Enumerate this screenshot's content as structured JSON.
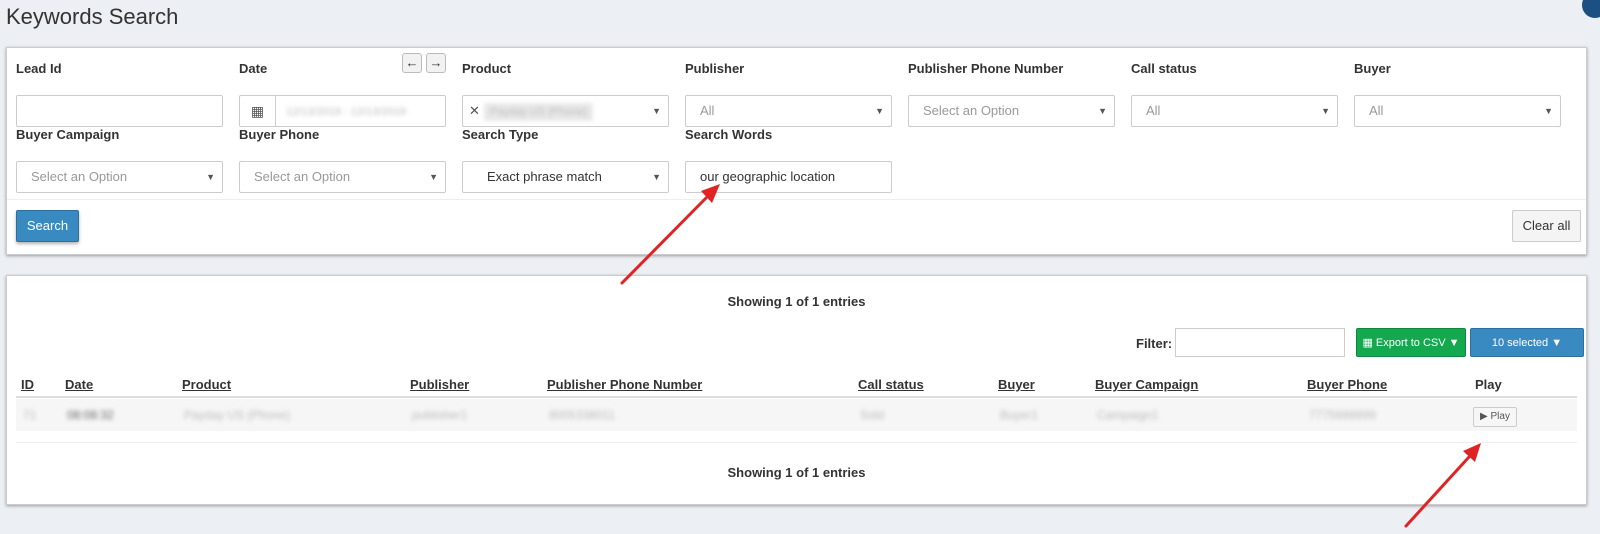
{
  "page": {
    "title": "Keywords Search"
  },
  "filters": {
    "lead_id": {
      "label": "Lead Id",
      "value": ""
    },
    "date": {
      "label": "Date",
      "value": "12/13/2019 - 12/13/2019",
      "prev_icon": "arrow-left-icon",
      "next_icon": "arrow-right-icon",
      "calendar_icon": "calendar-icon"
    },
    "product": {
      "label": "Product",
      "value": "Payday US (Phone)"
    },
    "publisher": {
      "label": "Publisher",
      "value": "All"
    },
    "publisher_phone": {
      "label": "Publisher Phone Number",
      "placeholder": "Select an Option"
    },
    "call_status": {
      "label": "Call status",
      "value": "All"
    },
    "buyer": {
      "label": "Buyer",
      "value": "All"
    },
    "buyer_campaign": {
      "label": "Buyer Campaign",
      "placeholder": "Select an Option"
    },
    "buyer_phone": {
      "label": "Buyer Phone",
      "placeholder": "Select an Option"
    },
    "search_type": {
      "label": "Search Type",
      "value": "Exact phrase match"
    },
    "search_words": {
      "label": "Search Words",
      "value": "our geographic location"
    },
    "search_button": "Search",
    "clear_button": "Clear all"
  },
  "results": {
    "showing_top": "Showing 1 of 1 entries",
    "showing_bottom": "Showing 1 of 1 entries",
    "filter_label": "Filter:",
    "export_button": "Export to CSV",
    "selected_button": "10 selected",
    "columns": [
      "ID",
      "Date",
      "Product",
      "Publisher",
      "Publisher Phone Number",
      "Call status",
      "Buyer",
      "Buyer Campaign",
      "Buyer Phone",
      "Play"
    ],
    "rows": [
      {
        "id": "71",
        "date": "08:08:32",
        "product": "Payday US (Phone)",
        "publisher": "publisher1",
        "publisher_phone": "8005338011",
        "call_status": "Sold",
        "buyer": "Buyer1",
        "buyer_campaign": "Campaign1",
        "buyer_phone": "7775688899",
        "play": "Play"
      }
    ]
  },
  "colors": {
    "primary": "#3a8ac2",
    "success": "#14a84f",
    "annotation": "#e02424"
  }
}
